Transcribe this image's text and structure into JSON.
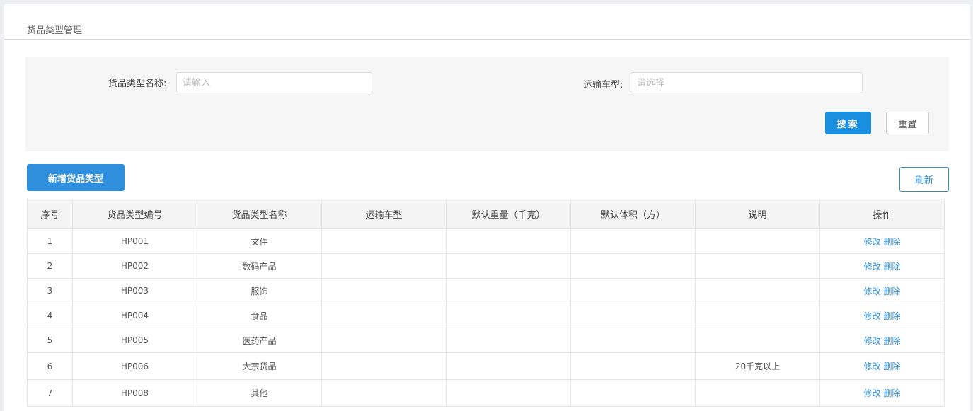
{
  "page": {
    "title": "货品类型管理"
  },
  "filters": {
    "name_label": "货品类型名称:",
    "name_placeholder": "请输入",
    "name_value": "",
    "vehicle_label": "运输车型:",
    "vehicle_placeholder": "请选择",
    "vehicle_value": ""
  },
  "buttons": {
    "search": "搜索",
    "reset": "重置",
    "add": "新增货品类型",
    "refresh": "刷新"
  },
  "table": {
    "columns": [
      "序号",
      "货品类型编号",
      "货品类型名称",
      "运输车型",
      "默认重量（千克）",
      "默认体积（方）",
      "说明",
      "操作"
    ],
    "rows": [
      {
        "index": "1",
        "code": "HP001",
        "name": "文件",
        "vehicle": "",
        "weight": "",
        "volume": "",
        "note": "",
        "edit": "修改",
        "delete": "删除"
      },
      {
        "index": "2",
        "code": "HP002",
        "name": "数码产品",
        "vehicle": "",
        "weight": "",
        "volume": "",
        "note": "",
        "edit": "修改",
        "delete": "删除"
      },
      {
        "index": "3",
        "code": "HP003",
        "name": "服饰",
        "vehicle": "",
        "weight": "",
        "volume": "",
        "note": "",
        "edit": "修改",
        "delete": "删除"
      },
      {
        "index": "4",
        "code": "HP004",
        "name": "食品",
        "vehicle": "",
        "weight": "",
        "volume": "",
        "note": "",
        "edit": "修改",
        "delete": "删除"
      },
      {
        "index": "5",
        "code": "HP005",
        "name": "医药产品",
        "vehicle": "",
        "weight": "",
        "volume": "",
        "note": "",
        "edit": "修改",
        "delete": "删除"
      },
      {
        "index": "6",
        "code": "HP006",
        "name": "大宗货品",
        "vehicle": "",
        "weight": "",
        "volume": "",
        "note": "20千克以上",
        "edit": "修改",
        "delete": "删除"
      },
      {
        "index": "7",
        "code": "HP008",
        "name": "其他",
        "vehicle": "",
        "weight": "",
        "volume": "",
        "note": "",
        "edit": "修改",
        "delete": "删除"
      }
    ]
  },
  "colors": {
    "primary": "#1a8fe0",
    "link": "#2f8fdc"
  }
}
